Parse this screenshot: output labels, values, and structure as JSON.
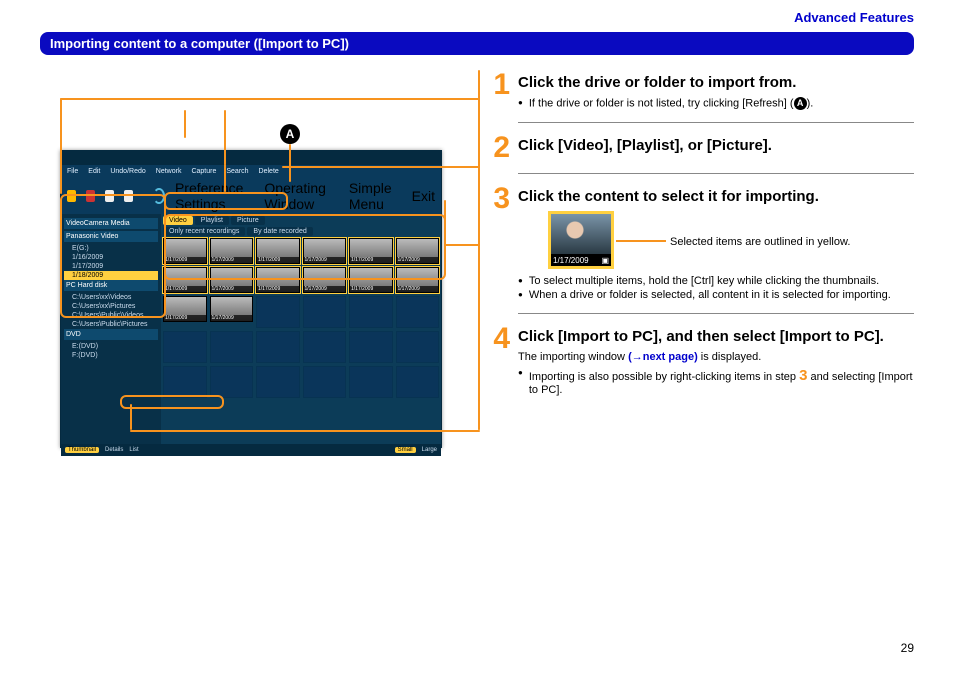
{
  "page": {
    "number": "29"
  },
  "header": {
    "advanced_link": "Advanced Features"
  },
  "bluebar": {
    "title": "Importing content to a computer ([Import to PC])"
  },
  "marker": {
    "refresh_letter": "A"
  },
  "app": {
    "menu": [
      "File",
      "Edit",
      "Undo/Redo",
      "Network",
      "Capture",
      "Search",
      "Delete"
    ],
    "right_items": [
      "Preference Settings",
      "Operating Window",
      "Simple Menu",
      "Exit"
    ],
    "sidebar": {
      "header1": "VideoCamera Media",
      "header2": "Panasonic Video",
      "drive": "E(G:)",
      "dates": [
        "1/16/2009",
        "1/17/2009",
        "1/18/2009"
      ],
      "pc_hdr": "PC Hard disk",
      "pc_items": [
        "C:\\Users\\xx\\Videos",
        "C:\\Users\\xx\\Pictures",
        "C:\\Users\\Public\\Videos",
        "C:\\Users\\Public\\Pictures"
      ],
      "dvd_hdr": "DVD",
      "dvd_items": [
        "E:(DVD)",
        "F:(DVD)"
      ]
    },
    "tabs_list": {
      "video": "Video",
      "playlist": "Playlist",
      "picture": "Picture"
    },
    "tabrow2": {
      "recent": "Only recent recordings",
      "date": "By date recorded"
    },
    "thumb_date_primary": "1/17/2009",
    "thumb_date_alt": "1/17/2009",
    "footer": {
      "thumb": "Thumbnail",
      "details": "Details",
      "list": "List",
      "small": "Small",
      "large": "Large"
    }
  },
  "steps": {
    "s1": {
      "title": "Click the drive or folder to import from.",
      "bullet1_a": "If the drive or folder is not listed, try clicking [Refresh] (",
      "bullet1_b": ")."
    },
    "s2": {
      "title": "Click [Video], [Playlist], or [Picture]."
    },
    "s3": {
      "title": "Click the content to select it for importing.",
      "sel_caption": "Selected items are outlined in yellow.",
      "sel_date": "1/17/2009",
      "bullet1": "To select multiple items, hold the [Ctrl] key while clicking the thumbnails.",
      "bullet2": "When a drive or folder is selected, all content in it is selected for importing."
    },
    "s4": {
      "title": "Click [Import to PC], and then select [Import to PC].",
      "text_a": "The importing window ",
      "link": "(→next page)",
      "text_b": " is displayed.",
      "bullet_a": "Importing is also possible by right-clicking items in step ",
      "bullet_num": "3",
      "bullet_b": " and selecting [Import to PC]."
    }
  }
}
